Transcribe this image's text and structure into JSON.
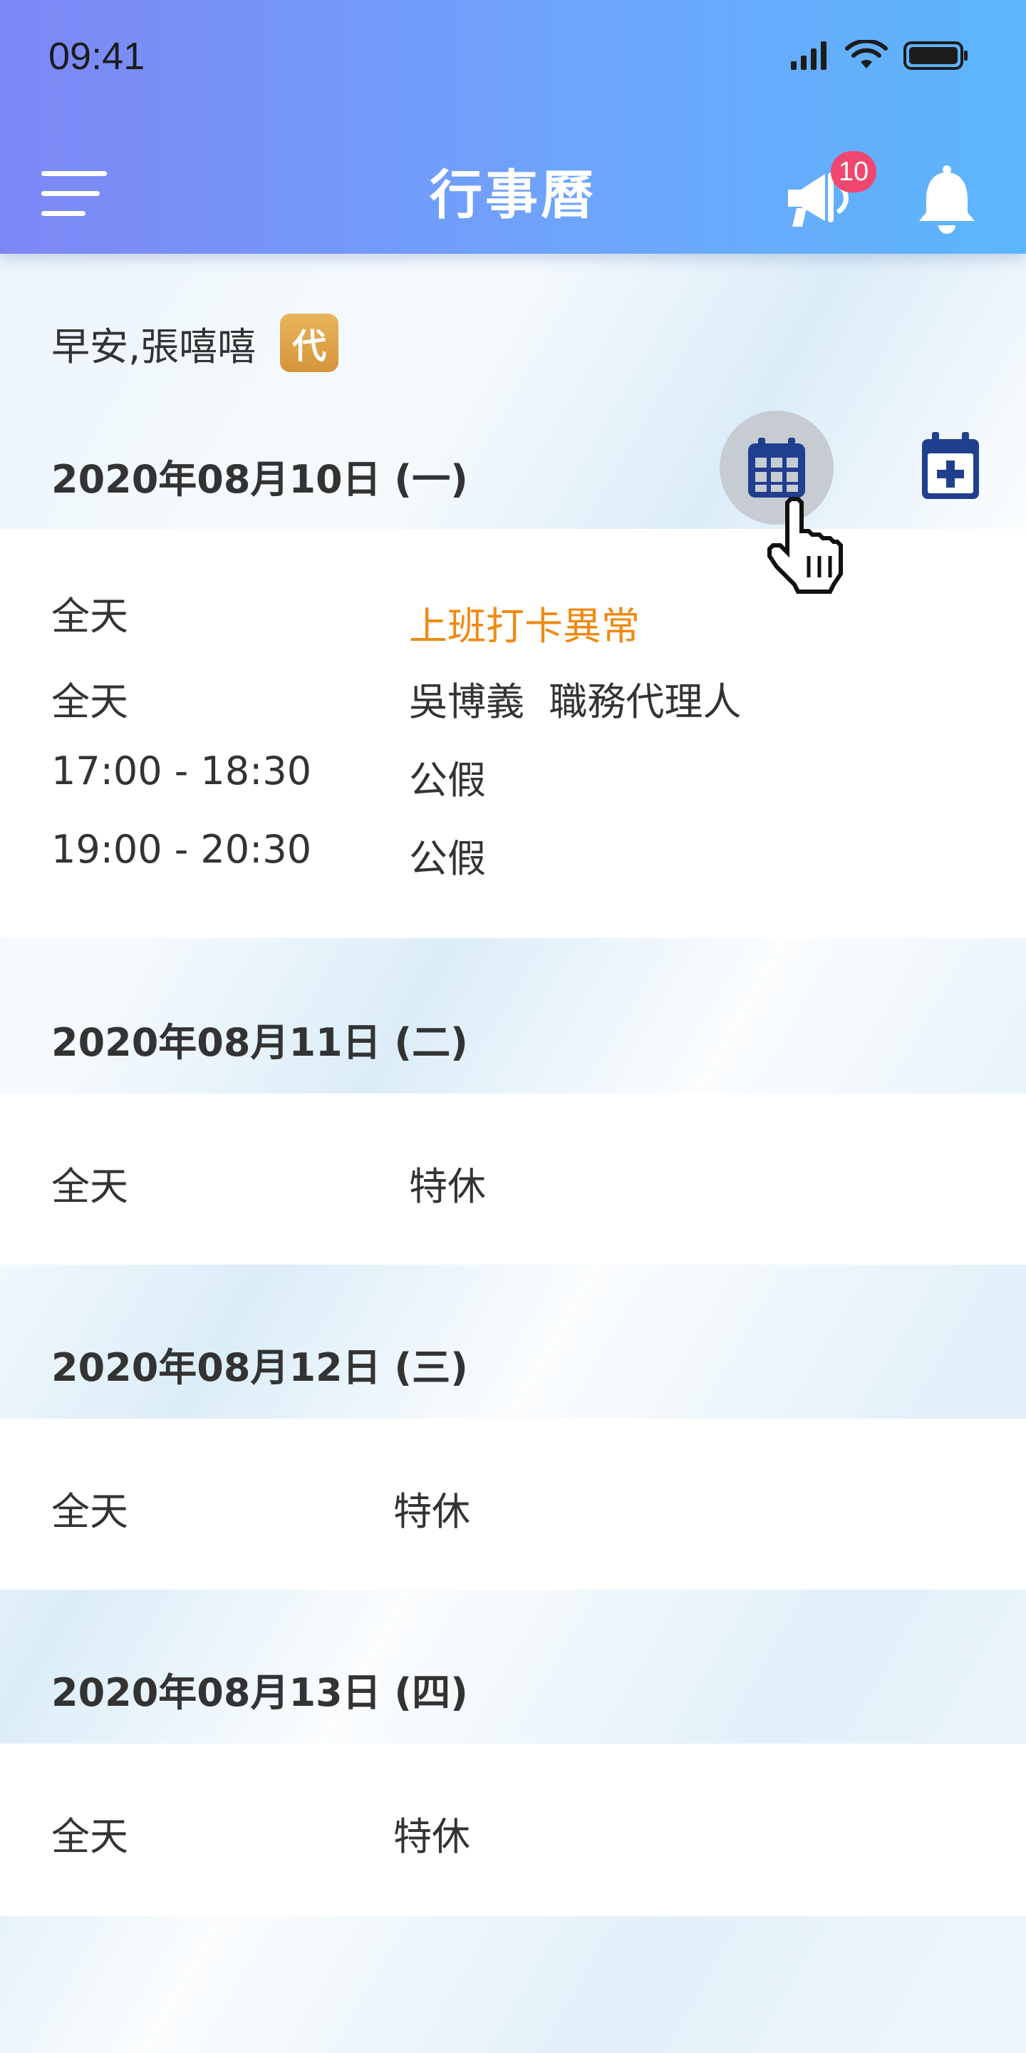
{
  "status_bar": {
    "time": "09:41"
  },
  "header": {
    "title": "行事曆",
    "notification_count": "10"
  },
  "greeting": {
    "text": "早安,張嘻嘻",
    "proxy_badge": "代"
  },
  "days": [
    {
      "date": "2020年08月10日 (一)",
      "events": [
        {
          "time": "全天",
          "desc": "上班打卡異常",
          "alert": true
        },
        {
          "time": "全天",
          "desc": "吳博義  職務代理人"
        },
        {
          "time": "17:00 - 18:30",
          "desc": "公假"
        },
        {
          "time": "19:00 - 20:30",
          "desc": "公假"
        }
      ]
    },
    {
      "date": "2020年08月11日 (二)",
      "events": [
        {
          "time": "全天",
          "desc": "特休"
        }
      ]
    },
    {
      "date": "2020年08月12日 (三)",
      "events": [
        {
          "time": "全天",
          "desc": "特休"
        }
      ]
    },
    {
      "date": "2020年08月13日 (四)",
      "events": [
        {
          "time": "全天",
          "desc": "特休"
        }
      ]
    }
  ],
  "colors": {
    "header_gradient_start": "#7d87f5",
    "header_gradient_end": "#5cb6fd",
    "badge": "#f0476f",
    "alert_text": "#ef8a14",
    "proxy_badge": "#dfa24a",
    "calendar_icon": "#1f3f8f"
  },
  "icons": {
    "menu": "menu-icon",
    "announcement": "megaphone-icon",
    "notifications": "bell-icon",
    "calendar_view": "calendar-grid-icon",
    "add_event": "calendar-add-icon",
    "cursor": "hand-pointer-icon"
  }
}
